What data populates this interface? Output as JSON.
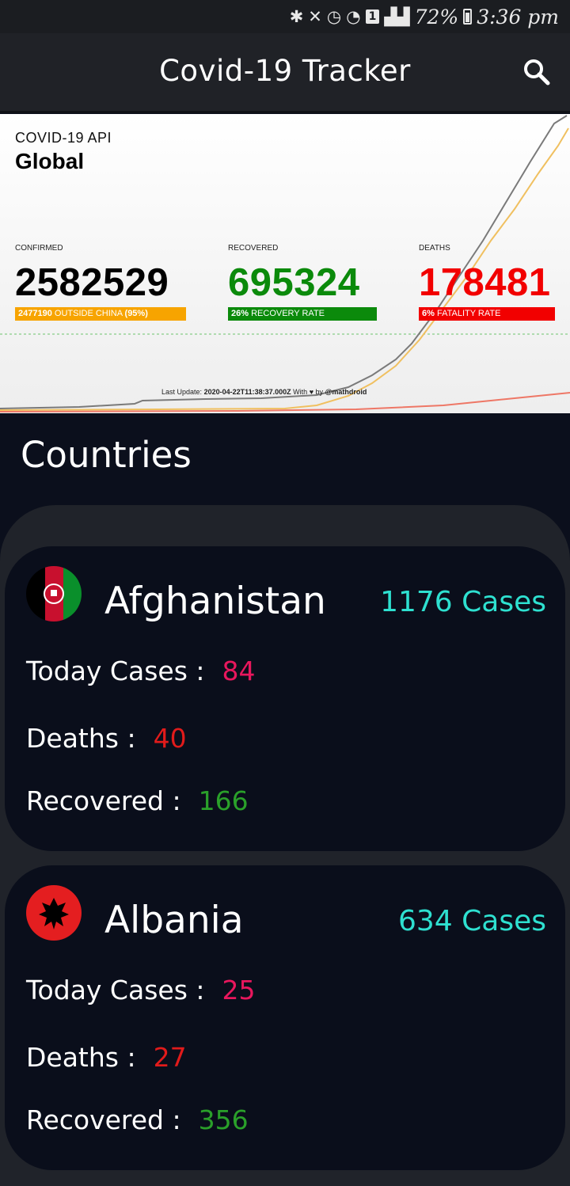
{
  "status_bar": {
    "battery": "72%",
    "time": "3:36 pm",
    "sim": "1",
    "icons": [
      "bluetooth-icon",
      "mute-icon",
      "alarm-icon",
      "wifi-icon",
      "signal-icon",
      "battery-icon"
    ]
  },
  "app_bar": {
    "title": "Covid-19 Tracker",
    "search_icon": "search-icon"
  },
  "banner": {
    "api_label": "COVID-19 API",
    "region": "Global",
    "confirmed": {
      "label": "CONFIRMED",
      "value": "2582529",
      "tag_strong": "2477190",
      "tag_rest": "OUTSIDE CHINA",
      "tag_pct": "(95%)",
      "color": "#f7a400"
    },
    "recovered": {
      "label": "RECOVERED",
      "value": "695324",
      "tag_strong": "26%",
      "tag_rest": "RECOVERY RATE",
      "color": "#0b8a0b"
    },
    "deaths": {
      "label": "DEATHS",
      "value": "178481",
      "tag_strong": "6%",
      "tag_rest": "FATALITY RATE",
      "color": "#f20000"
    },
    "update_prefix": "Last Update:",
    "update_time": "2020-04-22T11:38:37.000Z",
    "update_with": "With",
    "update_by": "by",
    "update_author": "@mathdroid"
  },
  "countries_title": "Countries",
  "countries": [
    {
      "name": "Afghanistan",
      "cases": "1176 Cases",
      "today_label": "Today Cases :",
      "today": "84",
      "deaths_label": "Deaths :",
      "deaths": "40",
      "recovered_label": "Recovered :",
      "recovered": "166",
      "flag_icon": "afghanistan-flag-icon"
    },
    {
      "name": "Albania",
      "cases": "634 Cases",
      "today_label": "Today Cases :",
      "today": "25",
      "deaths_label": "Deaths :",
      "deaths": "27",
      "recovered_label": "Recovered :",
      "recovered": "356",
      "flag_icon": "albania-flag-icon"
    }
  ],
  "colors": {
    "cases": "#2ee0d0",
    "today": "#e8175d",
    "deaths": "#e11b1b",
    "recovered": "#2aa02a"
  }
}
